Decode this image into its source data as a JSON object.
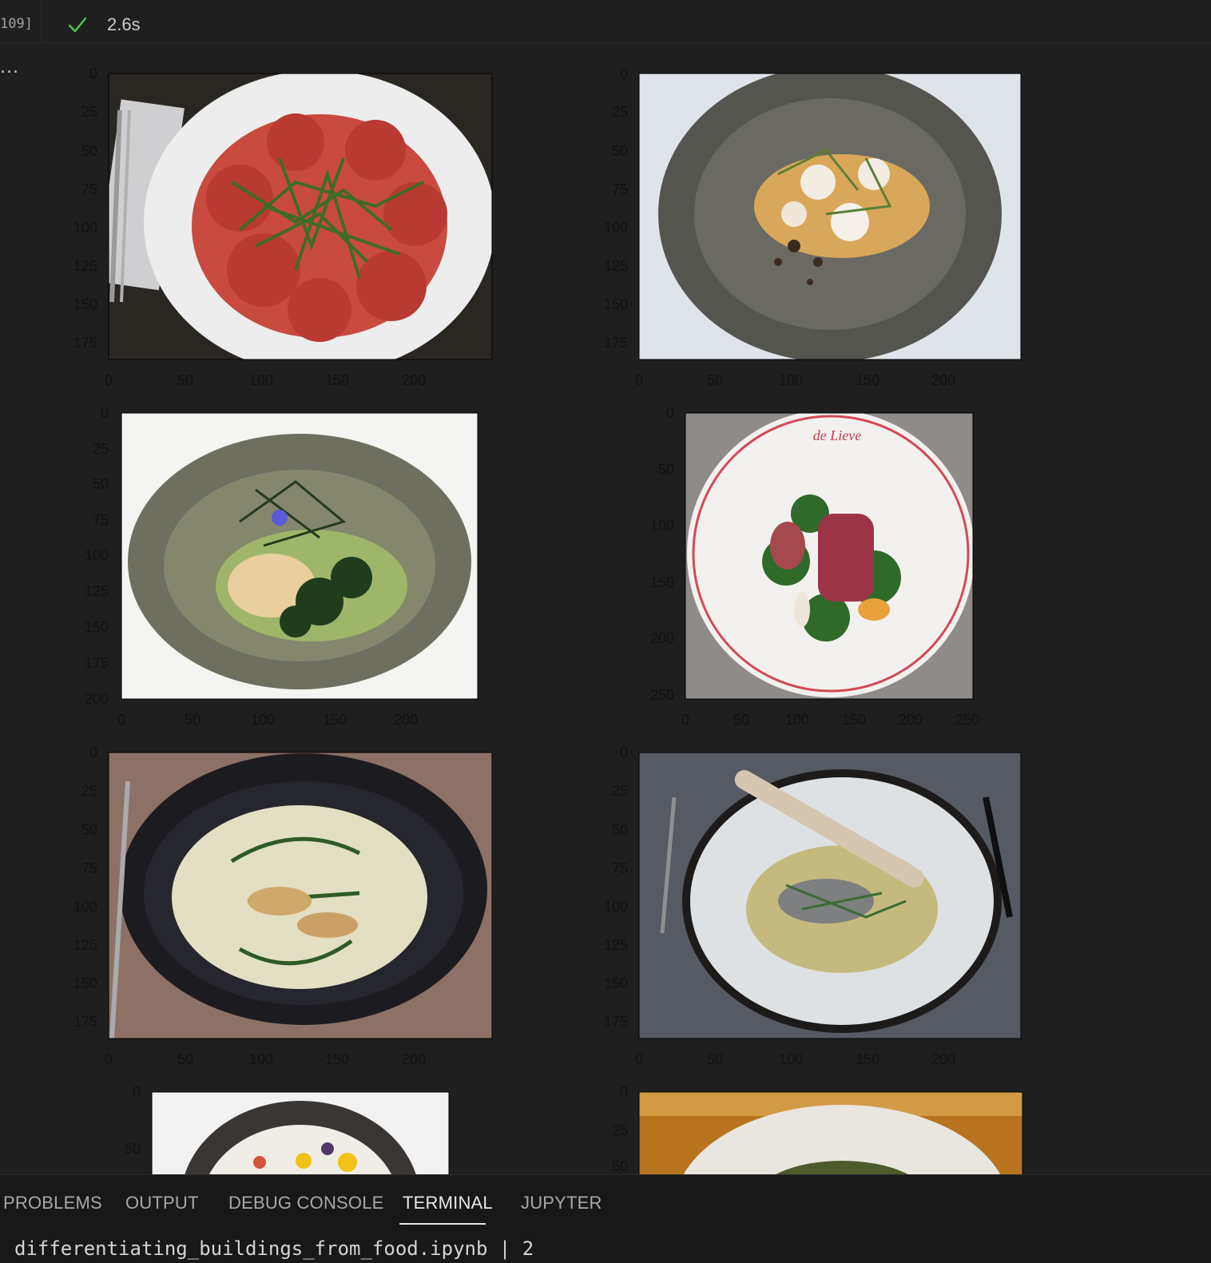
{
  "cell": {
    "execution_count": "109]",
    "duration": "2.6s",
    "output_ellipsis": "..."
  },
  "icons": {
    "status": "check-icon"
  },
  "colors": {
    "success": "#4ec94e",
    "active_tab_underline": "#e7e7e7"
  },
  "subplots": [
    {
      "id": "img-1",
      "subject": "beef-carpaccio-arugula",
      "y_ticks": [
        "0",
        "25",
        "50",
        "75",
        "100",
        "125",
        "150",
        "175"
      ],
      "x_ticks": [
        "0",
        "50",
        "100",
        "150",
        "200"
      ]
    },
    {
      "id": "img-2",
      "subject": "meringue-dessert-grey-bowl",
      "y_ticks": [
        "0",
        "25",
        "50",
        "75",
        "100",
        "125",
        "150",
        "175"
      ],
      "x_ticks": [
        "0",
        "50",
        "100",
        "150",
        "200"
      ]
    },
    {
      "id": "img-3",
      "subject": "fish-broccoli-green-sauce",
      "y_ticks": [
        "0",
        "25",
        "50",
        "75",
        "100",
        "125",
        "150",
        "175",
        "200"
      ],
      "x_ticks": [
        "0",
        "50",
        "100",
        "150",
        "200"
      ]
    },
    {
      "id": "img-4",
      "subject": "duck-breast-salad-red-rim-plate",
      "plate_text": "de Lieve",
      "y_ticks": [
        "0",
        "50",
        "100",
        "150",
        "200",
        "250"
      ],
      "x_ticks": [
        "0",
        "50",
        "100",
        "150",
        "200",
        "250"
      ]
    },
    {
      "id": "img-5",
      "subject": "soup-with-fish-and-herbs",
      "y_ticks": [
        "0",
        "25",
        "50",
        "75",
        "100",
        "125",
        "150",
        "175"
      ],
      "x_ticks": [
        "0",
        "50",
        "100",
        "150",
        "200"
      ]
    },
    {
      "id": "img-6",
      "subject": "fish-with-breadstick-broth",
      "y_ticks": [
        "0",
        "25",
        "50",
        "75",
        "100",
        "125",
        "150",
        "175"
      ],
      "x_ticks": [
        "0",
        "50",
        "100",
        "150",
        "200"
      ]
    },
    {
      "id": "img-7",
      "subject": "dish-with-yellow-flowers",
      "y_ticks": [
        "0",
        "50"
      ],
      "x_ticks": []
    },
    {
      "id": "img-8",
      "subject": "dish-in-white-bowl",
      "y_ticks": [
        "0",
        "25",
        "50"
      ],
      "x_ticks": []
    }
  ],
  "panel": {
    "tabs": [
      "PROBLEMS",
      "OUTPUT",
      "DEBUG CONSOLE",
      "TERMINAL",
      "JUPYTER"
    ],
    "active_tab": "TERMINAL",
    "terminal_text": "differentiating_buildings_from_food.ipynb | 2"
  }
}
